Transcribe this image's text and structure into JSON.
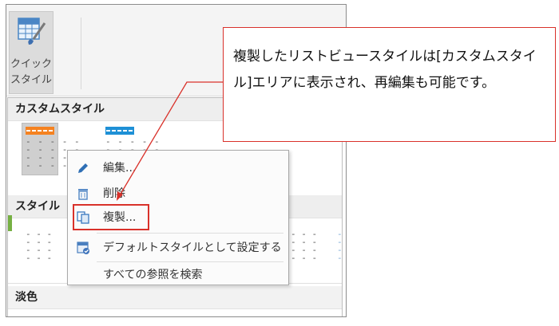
{
  "ribbon": {
    "quick_style_label": "クイック\nスタイル",
    "quick_style_line1": "クイック",
    "quick_style_line2": "スタイル"
  },
  "gallery": {
    "sections": {
      "custom": "カスタムスタイル",
      "style": "スタイル",
      "light": "淡色"
    }
  },
  "context_menu": {
    "items": [
      {
        "label": "編集...",
        "icon": "pencil-icon"
      },
      {
        "label": "削除",
        "icon": "trash-icon"
      },
      {
        "label": "複製...",
        "icon": "copy-icon"
      },
      {
        "label": "デフォルトスタイルとして設定する",
        "icon": "default-style-icon"
      },
      {
        "label": "すべての参照を検索",
        "icon": ""
      }
    ]
  },
  "callout": {
    "text": "複製したリストビュースタイルは[カスタムスタイル]エリアに表示され、再編集も可能です。"
  },
  "colors": {
    "orange_accent": "#f58220",
    "blue_accent": "#1e90d6",
    "annotation_red": "#d9312a"
  }
}
